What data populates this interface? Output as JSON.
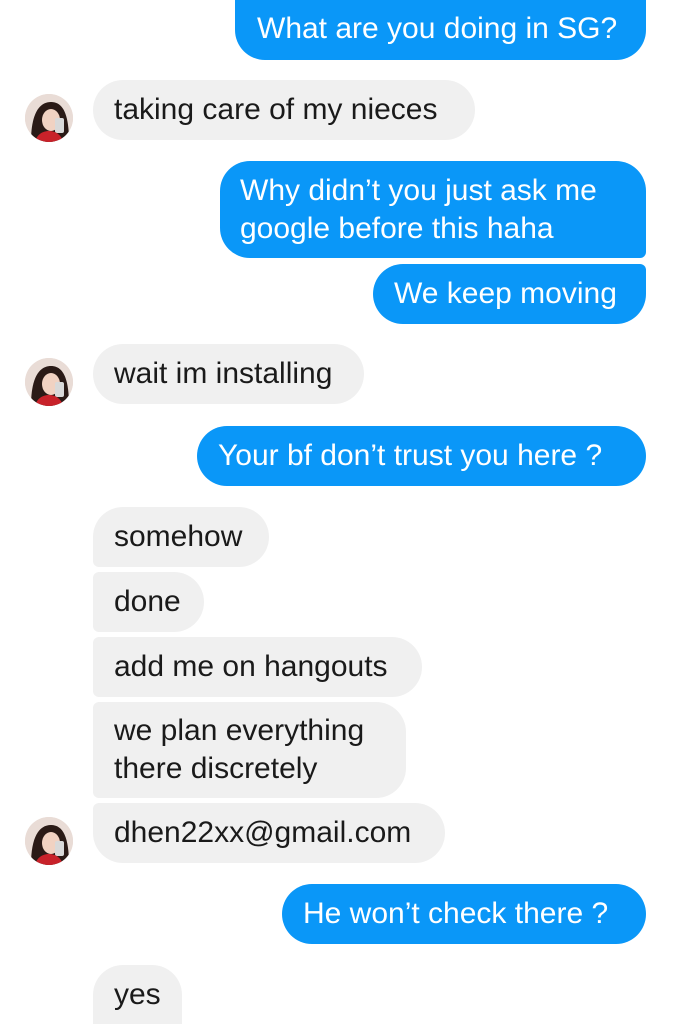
{
  "chat": {
    "messages": [
      {
        "direction": "outgoing",
        "text": "What are you doing in SG?"
      },
      {
        "direction": "incoming",
        "text": "taking care of my nieces",
        "avatar": "contact-avatar"
      },
      {
        "direction": "outgoing",
        "text": "Why didn’t you just ask me google before this haha"
      },
      {
        "direction": "outgoing",
        "text": "We keep moving"
      },
      {
        "direction": "incoming",
        "text": "wait im installing",
        "avatar": "contact-avatar"
      },
      {
        "direction": "outgoing",
        "text": "Your bf don’t trust you here ?"
      },
      {
        "direction": "incoming",
        "text": "somehow"
      },
      {
        "direction": "incoming",
        "text": "done"
      },
      {
        "direction": "incoming",
        "text": "add me on hangouts"
      },
      {
        "direction": "incoming",
        "text": "we plan everything there discretely"
      },
      {
        "direction": "incoming",
        "text": "dhen22xx@gmail.com",
        "avatar": "contact-avatar"
      },
      {
        "direction": "outgoing",
        "text": "He won’t check there ?"
      },
      {
        "direction": "incoming",
        "text": "yes"
      }
    ]
  },
  "colors": {
    "outgoing_bubble": "#0a97f8",
    "incoming_bubble": "#f0f0f0",
    "outgoing_text": "#ffffff",
    "incoming_text": "#1a1a1a"
  }
}
